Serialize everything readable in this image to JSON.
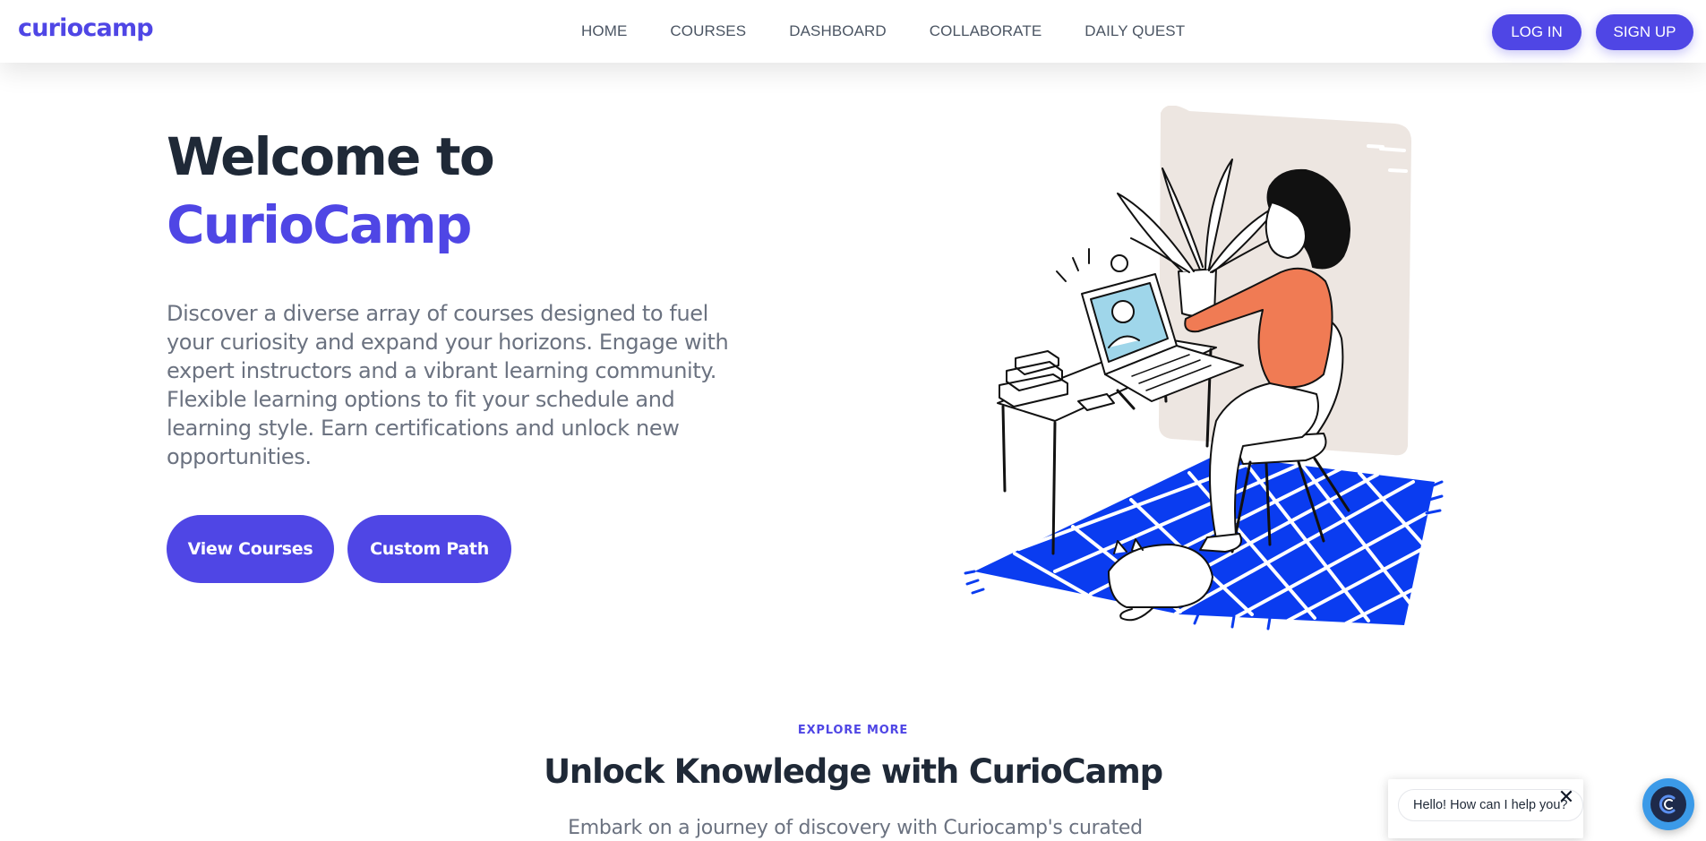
{
  "brand": {
    "logo_text": "curiocamp",
    "accent": "#4f46e5",
    "dark": "#1f2937",
    "muted": "#6b7280"
  },
  "nav": {
    "items": [
      {
        "label": "HOME"
      },
      {
        "label": "COURSES"
      },
      {
        "label": "DASHBOARD"
      },
      {
        "label": "COLLABORATE"
      },
      {
        "label": "DAILY QUEST"
      }
    ],
    "login_label": "LOG IN",
    "signup_label": "SIGN UP"
  },
  "hero": {
    "title_line1": "Welcome to",
    "title_line2": "CurioCamp",
    "description": "Discover a diverse array of courses designed to fuel your curiosity and expand your horizons. Engage with expert instructors and a vibrant learning community. Flexible learning options to fit your schedule and learning style. Earn certifications and unlock new opportunities.",
    "primary_cta": "View Courses",
    "secondary_cta": "Custom Path",
    "illustration_colors": {
      "rug": "#0a3cf0",
      "sweater": "#f07b54",
      "panel": "#ede6e1"
    }
  },
  "explore": {
    "eyebrow": "EXPLORE MORE",
    "title": "Unlock Knowledge with CurioCamp",
    "subtitle": "Embark on a journey of discovery with Curiocamp's curated"
  },
  "chat": {
    "greeting": "Hello! How can I help you?",
    "close_icon": "close-icon",
    "launcher_icon": "chatbot-logo-icon",
    "launcher_color": "#3b9ae8"
  }
}
